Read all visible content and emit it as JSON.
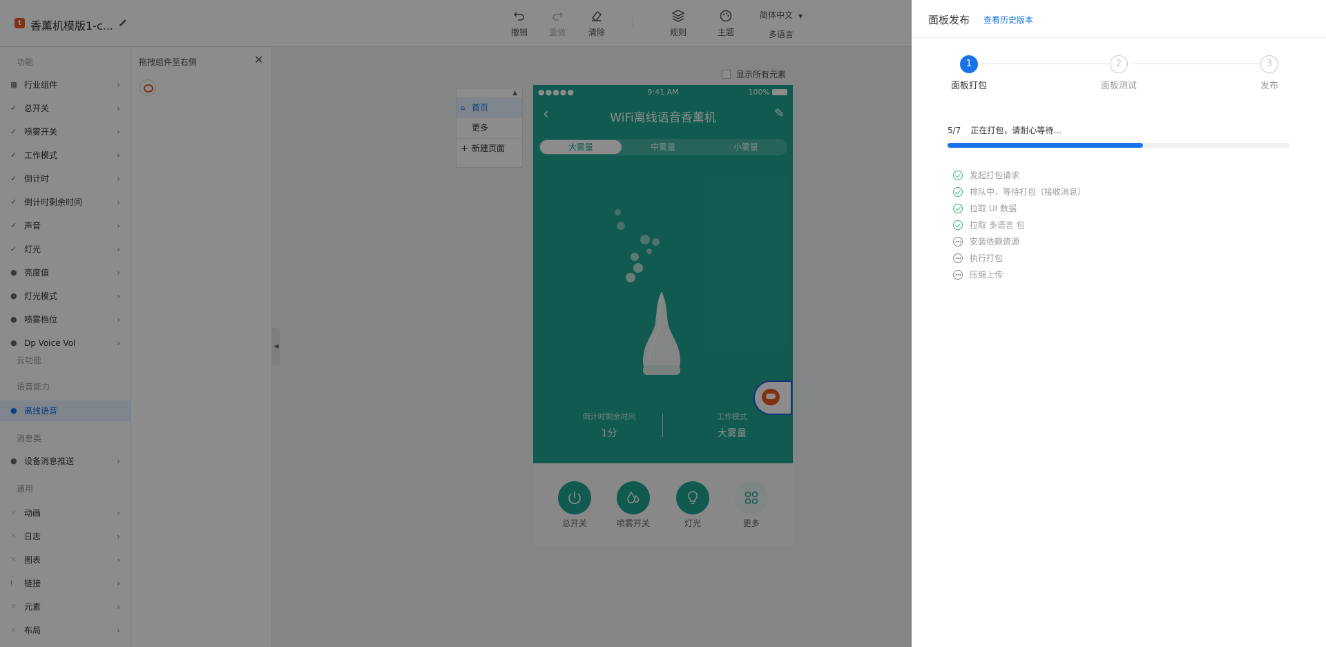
{
  "app": {
    "logo_text": "t",
    "title": "香薰机模版1-c..."
  },
  "toolbar": {
    "undo": "撤销",
    "redo": "重做",
    "clear": "清除",
    "rules": "规则",
    "theme": "主题",
    "language_select": "简体中文",
    "multilang": "多语言"
  },
  "sidebar": {
    "section_functions": "功能",
    "items": [
      {
        "label": "行业组件",
        "icon": "grid-icon"
      },
      {
        "label": "总开关",
        "icon": "check-icon"
      },
      {
        "label": "喷雾开关",
        "icon": "check-icon"
      },
      {
        "label": "工作模式",
        "icon": "check-icon"
      },
      {
        "label": "倒计时",
        "icon": "check-icon"
      },
      {
        "label": "倒计时剩余时间",
        "icon": "check-icon"
      },
      {
        "label": "声音",
        "icon": "check-icon"
      },
      {
        "label": "灯光",
        "icon": "check-icon"
      },
      {
        "label": "亮度值",
        "icon": "dp-icon"
      },
      {
        "label": "灯光模式",
        "icon": "dp-icon"
      },
      {
        "label": "喷雾档位",
        "icon": "dp-icon"
      },
      {
        "label": "Dp Voice Vol",
        "icon": "dp-icon"
      }
    ],
    "section_cloud": "云功能",
    "section_voice": "语音能力",
    "voice_item": "离线语音",
    "section_message": "消息类",
    "message_item": "设备消息推送",
    "section_general": "通用",
    "general_items": [
      {
        "label": "动画"
      },
      {
        "label": "日志"
      },
      {
        "label": "图表"
      },
      {
        "label": "链接"
      },
      {
        "label": "元素"
      },
      {
        "label": "布局"
      }
    ]
  },
  "drawer": {
    "title": "拖拽组件至右侧"
  },
  "canvas": {
    "show_all": "显示所有元素",
    "pages": [
      "首页",
      "更多"
    ],
    "new_page": "新建页面"
  },
  "phone": {
    "signal": "●●●●●",
    "time": "9:41 AM",
    "battery": "100%",
    "title": "WiFi离线语音香薰机",
    "modes": [
      "大雾量",
      "中雾量",
      "小雾量"
    ],
    "stat_left_label": "倒计时剩余时间",
    "stat_left_value": "1分",
    "stat_right_label": "工作模式",
    "stat_right_value": "大雾量",
    "controls": [
      "总开关",
      "喷雾开关",
      "灯光",
      "更多"
    ]
  },
  "publish": {
    "title": "面板发布",
    "history_link": "查看历史版本",
    "steps": [
      {
        "num": "1",
        "label": "面板打包"
      },
      {
        "num": "2",
        "label": "面板测试"
      },
      {
        "num": "3",
        "label": "发布"
      }
    ],
    "progress_count": "5/7",
    "progress_message": "正在打包，请耐心等待...",
    "progress_fraction": 0.57,
    "tasks": [
      {
        "label": "发起打包请求",
        "status": "done"
      },
      {
        "label": "排队中，等待打包（接收消息）",
        "status": "done"
      },
      {
        "label": "拉取 UI 数据",
        "status": "done"
      },
      {
        "label": "拉取 多语言 包",
        "status": "done"
      },
      {
        "label": "安装依赖资源",
        "status": "pending"
      },
      {
        "label": "执行打包",
        "status": "pending"
      },
      {
        "label": "压缩上传",
        "status": "pending"
      }
    ]
  },
  "colors": {
    "accent": "#1a73e8",
    "device_teal": "#1fa593",
    "success": "#2eb872"
  }
}
